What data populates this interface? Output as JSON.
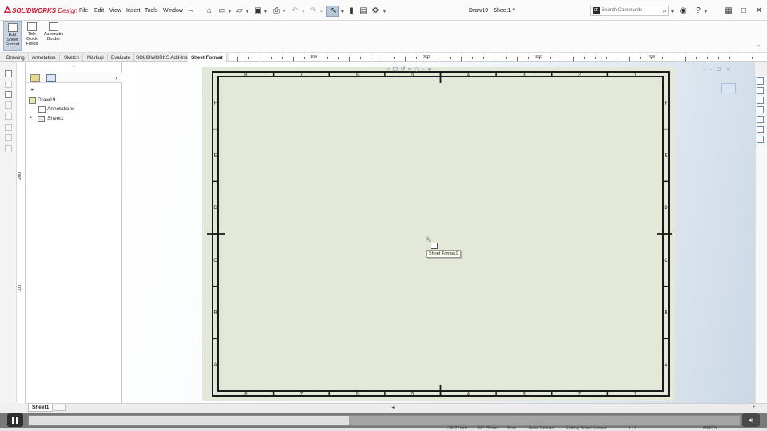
{
  "app": {
    "logo_brand": "SOLIDWORKS",
    "logo_product": "Design",
    "document_title": "Draw19 - Sheet1 *"
  },
  "menu": [
    "File",
    "Edit",
    "View",
    "Insert",
    "Tools",
    "Window"
  ],
  "toolbar": {
    "icons": [
      "home-icon",
      "new-document-icon",
      "open-icon",
      "save-icon",
      "print-icon",
      "undo-icon",
      "redo-icon",
      "select-icon",
      "traffic-light-icon",
      "file-properties-icon",
      "options-gear-icon"
    ]
  },
  "search": {
    "placeholder": "Search Commands"
  },
  "command_manager": {
    "edit_sheet_format": [
      "Edit",
      "Sheet",
      "Format"
    ],
    "title_block_fields": [
      "Title",
      "Block",
      "Fields"
    ],
    "automatic_border": [
      "Automatic",
      "Border"
    ]
  },
  "tabs": [
    "Drawing",
    "Annotation",
    "Sketch",
    "Markup",
    "Evaluate",
    "SOLIDWORKS Add-Ins",
    "Sheet Format"
  ],
  "active_tab": "Sheet Format",
  "ruler": {
    "horizontal": [
      "100",
      "200",
      "300",
      "400"
    ],
    "vertical": [
      "200",
      "100"
    ]
  },
  "feature_tree": {
    "root": "Draw19",
    "items": [
      "Annotations",
      "Sheet1"
    ]
  },
  "drawing": {
    "columns": [
      "8",
      "7",
      "6",
      "5",
      "4",
      "3",
      "2",
      "1"
    ],
    "rows": [
      "F",
      "E",
      "D",
      "C",
      "B",
      "A"
    ]
  },
  "tooltip": "Sheet Format1",
  "sheet_tab": "Sheet1",
  "player": {
    "progress_fraction": 0.45
  },
  "status": [
    "-96.21mm",
    "297.25mm",
    "0mm",
    "Under Defined",
    "Editing Sheet Format",
    "1 : 1",
    "MMGS"
  ]
}
